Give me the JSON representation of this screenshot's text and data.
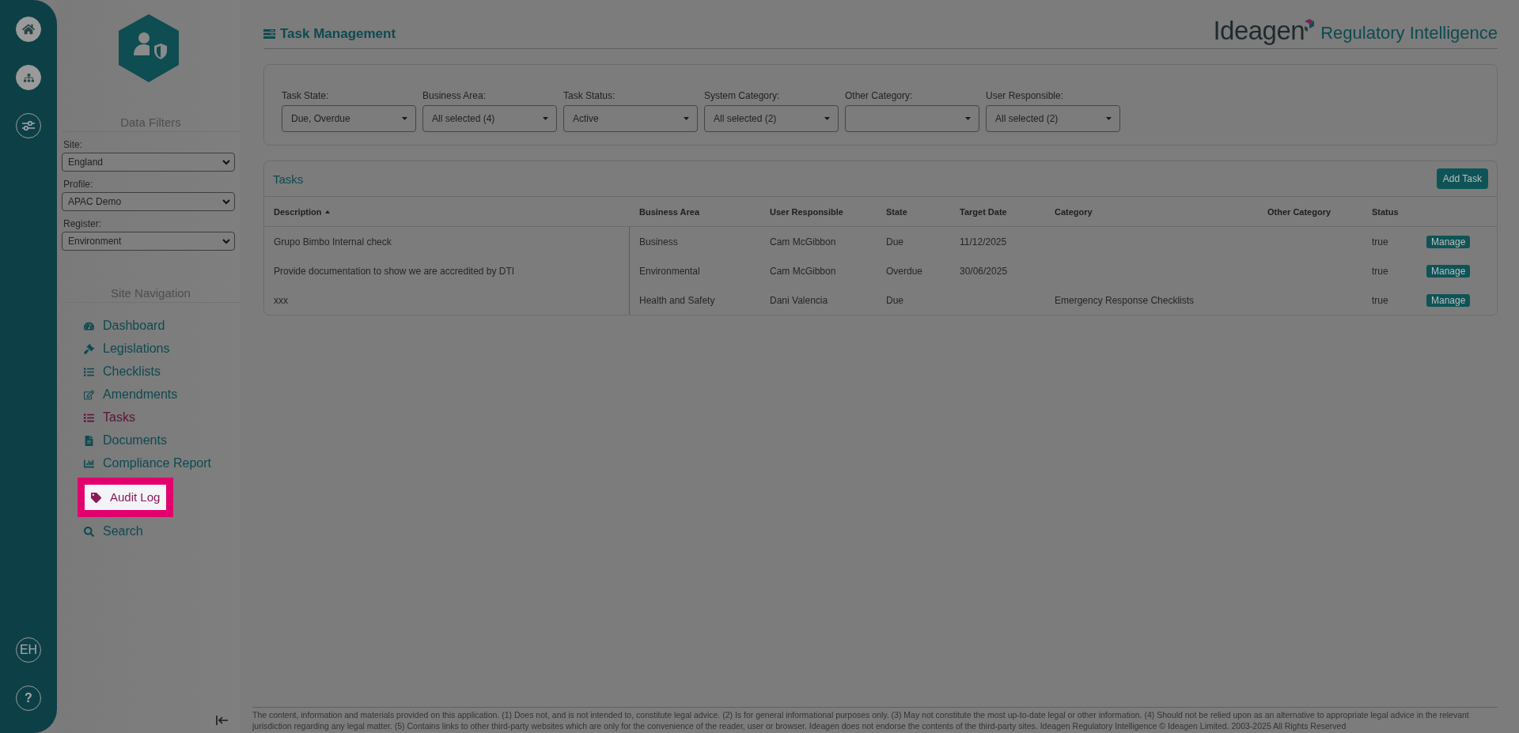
{
  "rail": {
    "user_initials": "EH",
    "help": "?"
  },
  "sidebar": {
    "filters_title": "Data Filters",
    "filters": [
      {
        "label": "Site:",
        "value": "England"
      },
      {
        "label": "Profile:",
        "value": "APAC Demo"
      },
      {
        "label": "Register:",
        "value": "Environment"
      }
    ],
    "nav_title": "Site Navigation",
    "nav": [
      {
        "label": "Dashboard",
        "selected": false,
        "highlighted": false
      },
      {
        "label": "Legislations",
        "selected": false,
        "highlighted": false
      },
      {
        "label": "Checklists",
        "selected": false,
        "highlighted": false
      },
      {
        "label": "Amendments",
        "selected": false,
        "highlighted": false
      },
      {
        "label": "Tasks",
        "selected": true,
        "highlighted": false
      },
      {
        "label": "Documents",
        "selected": false,
        "highlighted": false
      },
      {
        "label": "Compliance Report",
        "selected": false,
        "highlighted": false
      },
      {
        "label": "Audit Log",
        "selected": false,
        "highlighted": true
      },
      {
        "label": "Search",
        "selected": false,
        "highlighted": false
      }
    ]
  },
  "header": {
    "title": "Task Management",
    "brand": "Ideagen",
    "product": "Regulatory Intelligence"
  },
  "task_filters": [
    {
      "label": "Task State:",
      "value": "Due, Overdue"
    },
    {
      "label": "Business Area:",
      "value": "All selected (4)"
    },
    {
      "label": "Task Status:",
      "value": "Active"
    },
    {
      "label": "System Category:",
      "value": "All selected (2)"
    },
    {
      "label": "Other Category:"
    },
    {
      "label": "User Responsible:",
      "value": "All selected (2)"
    }
  ],
  "tasks": {
    "title": "Tasks",
    "add_button": "Add Task",
    "columns": [
      {
        "label": "Description",
        "sorted": true
      },
      {
        "label": "Business Area",
        "sorted": false
      },
      {
        "label": "User Responsible",
        "sorted": false
      },
      {
        "label": "State",
        "sorted": false
      },
      {
        "label": "Target Date",
        "sorted": false
      },
      {
        "label": "Category",
        "sorted": false
      },
      {
        "label": "Other Category",
        "sorted": false
      },
      {
        "label": "Status",
        "sorted": false
      }
    ],
    "rows": [
      {
        "cells": [
          "Grupo Bimbo Internal check",
          "Business",
          "Cam McGibbon",
          "Due",
          "11/12/2025",
          "",
          "",
          "true"
        ],
        "action": "Manage"
      },
      {
        "cells": [
          "Provide documentation to show we are accredited by DTI",
          "Environmental",
          "Cam McGibbon",
          "Overdue",
          "30/06/2025",
          "",
          "",
          "true"
        ],
        "action": "Manage"
      },
      {
        "cells": [
          "xxx",
          "Health and Safety",
          "Dani Valencia",
          "Due",
          "",
          "Emergency Response Checklists",
          "",
          "true"
        ],
        "action": "Manage"
      }
    ]
  },
  "footer": "The content, information and materials provided on this application. (1) Does not, and is not intended to, constitute legal advice. (2) Is for general informational purposes only. (3) May not constitute the most up-to-date legal or other information. (4) Should not be relied upon as an alternative to appropriate legal advice in the relevant jurisdiction regarding any legal matter. (5) Contains links to other third-party websites which are only for the convenience of the reader, user or browser. Ideagen does not endorse the contents of the third-party sites. Ideagen Regulatory Intelligence © Ideagen Limited. 2003-2025 All Rights Reserved"
}
